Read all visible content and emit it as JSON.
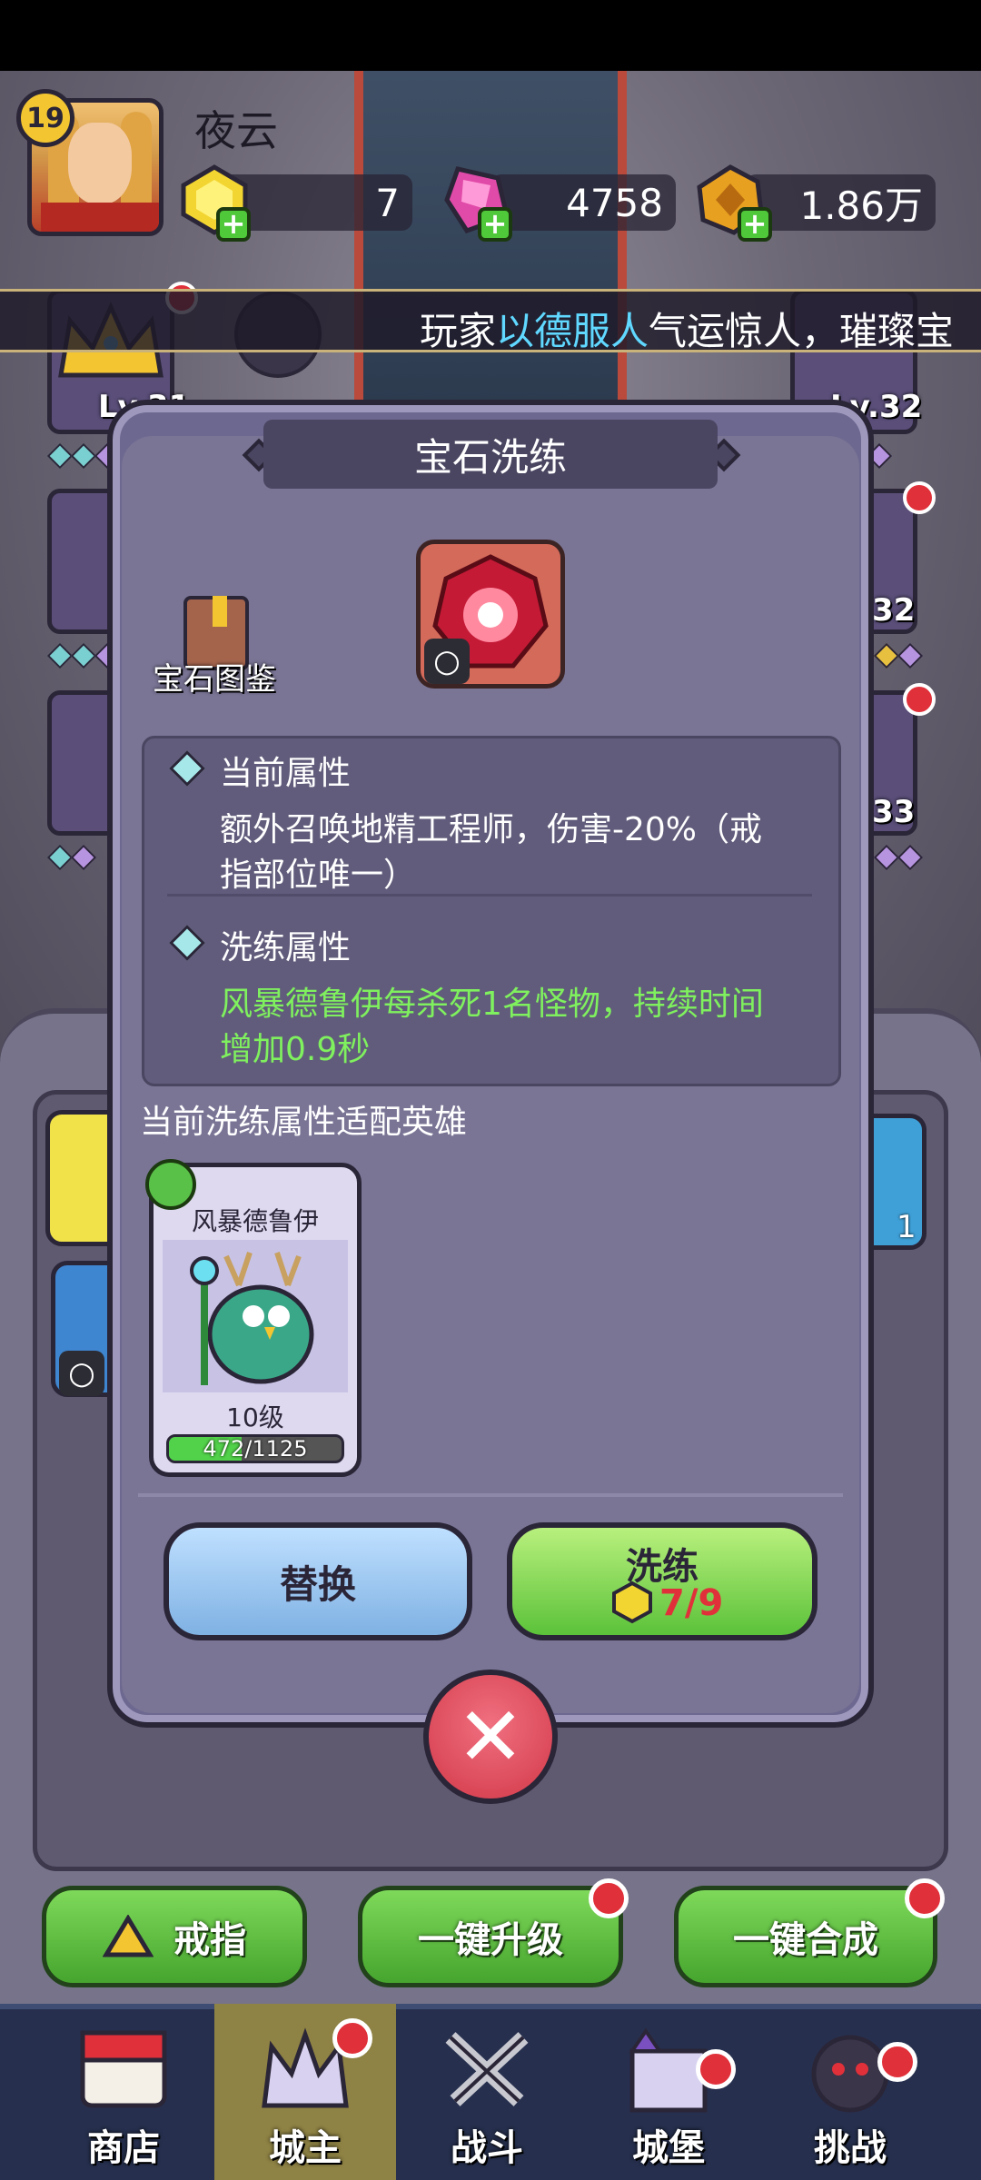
{
  "player": {
    "level": "19",
    "name": "夜云"
  },
  "resources": {
    "gold_gem": "7",
    "pink_gem": "4758",
    "coin": "1.86万"
  },
  "marquee": {
    "prefix": "玩家",
    "highlight": "以德服人",
    "suffix": "气运惊人，璀璨宝"
  },
  "background_slots": {
    "lv_left": "Lv.31",
    "lv_right": "Lv.32",
    "right_2": "32",
    "right_3": "33",
    "right_card_count": "1"
  },
  "dialog": {
    "title": "宝石洗练",
    "book_label": "宝石图鉴",
    "current_attr_title": "当前属性",
    "current_attr_line1": "额外召唤地精工程师，伤害-20%（戒",
    "current_attr_line2": "指部位唯一）",
    "refine_attr_title": "洗练属性",
    "refine_attr_line1": "风暴德鲁伊每杀死1名怪物，持续时间",
    "refine_attr_line2": "增加0.9秒",
    "hero_section_title": "当前洗练属性适配英雄",
    "hero": {
      "name": "风暴德鲁伊",
      "level": "10级",
      "xp_text": "472/1125",
      "xp_fraction": 0.42
    },
    "replace_label": "替换",
    "refine_label": "洗练",
    "refine_cost": "7/9"
  },
  "bottom_buttons": {
    "ring": "戒指",
    "upgrade_all": "一键升级",
    "merge_all": "一键合成"
  },
  "nav": {
    "shop": "商店",
    "lord": "城主",
    "battle": "战斗",
    "castle": "城堡",
    "challenge": "挑战"
  },
  "colors": {
    "accent_green": "#7ff05e",
    "highlight_cyan": "#60d8ff",
    "cost_red": "#e0303a",
    "notify_red": "#e0303a"
  }
}
